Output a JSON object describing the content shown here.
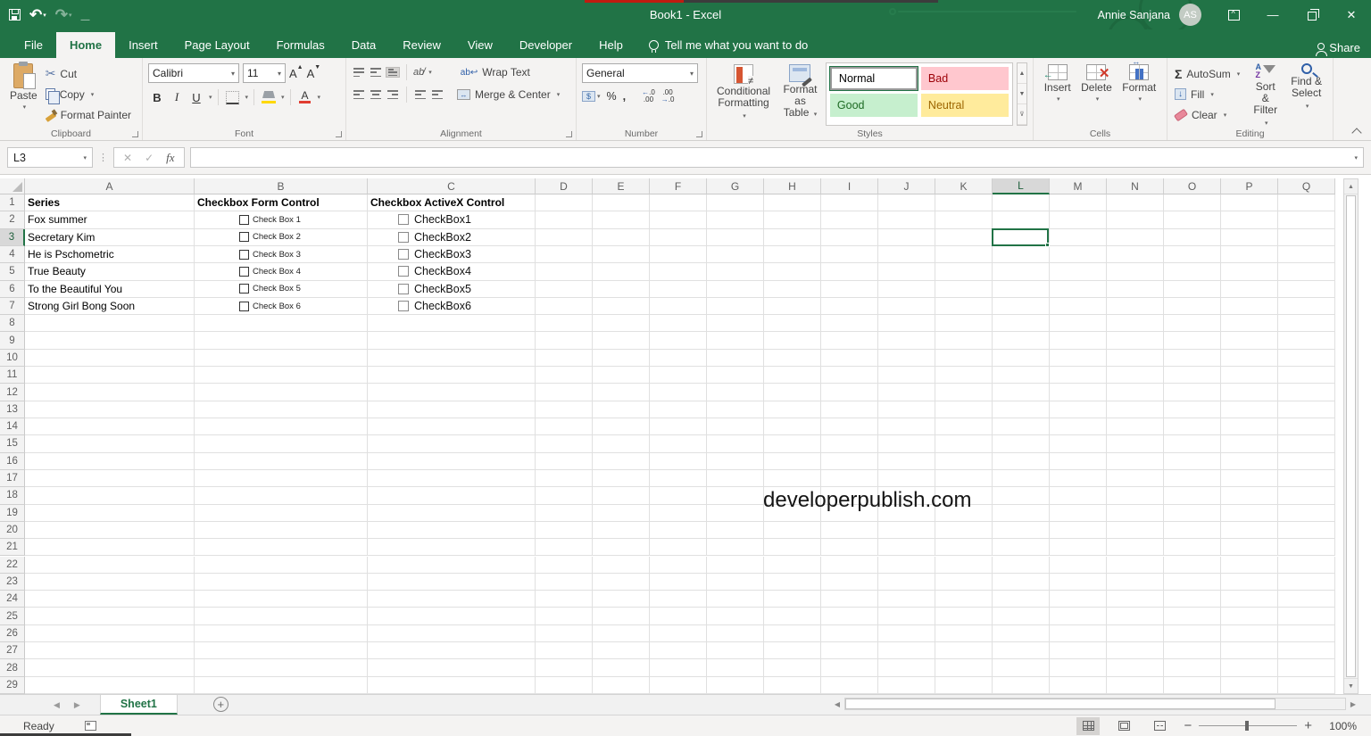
{
  "window": {
    "title": "Book1  -  Excel",
    "user_name": "Annie Sanjana",
    "user_initials": "AS"
  },
  "icons": {
    "cut_glyph": "✂",
    "close_glyph": "✕",
    "check_glyph": "✓",
    "fx_glyph": "fx",
    "minimize_glyph": "—",
    "caret_down": "▾",
    "up_arrow": "▲",
    "down_arrow": "▼",
    "left_arrow": "◀",
    "right_arrow": "▶",
    "undo_glyph": "↶",
    "redo_glyph": "↷",
    "sigma": "Σ",
    "fill_down": "↓",
    "merge_arrows": "↔",
    "wrap_ab": "ab",
    "wrap_return": "↩",
    "orientation": "ab̸",
    "insert_arrow": "←",
    "delete_x": "✕",
    "plus": "+",
    "formula_chevron": "▾",
    "dots": "⋮"
  },
  "tabs": {
    "items": [
      "File",
      "Home",
      "Insert",
      "Page Layout",
      "Formulas",
      "Data",
      "Review",
      "View",
      "Developer",
      "Help"
    ],
    "active": "Home",
    "tell_me": "Tell me what you want to do",
    "share": "Share"
  },
  "ribbon": {
    "clipboard": {
      "label": "Clipboard",
      "paste": "Paste",
      "cut": "Cut",
      "copy": "Copy",
      "format_painter": "Format Painter"
    },
    "font": {
      "label": "Font",
      "name": "Calibri",
      "size": "11",
      "bold": "B",
      "italic": "I",
      "underline": "U",
      "grow": "A",
      "shrink": "A",
      "color_a": "A"
    },
    "alignment": {
      "label": "Alignment",
      "wrap_text": "Wrap Text",
      "merge_center": "Merge & Center"
    },
    "number": {
      "label": "Number",
      "format": "General",
      "percent": "%",
      "comma": ",",
      "inc_decimal": ".00",
      "dec_decimal": ".00",
      "money": "$"
    },
    "styles": {
      "label": "Styles",
      "conditional_line1": "Conditional",
      "conditional_line2": "Formatting",
      "format_table_line1": "Format as",
      "format_table_line2": "Table",
      "normal": "Normal",
      "bad": "Bad",
      "good": "Good",
      "neutral": "Neutral"
    },
    "cells": {
      "label": "Cells",
      "insert": "Insert",
      "delete": "Delete",
      "format": "Format"
    },
    "editing": {
      "label": "Editing",
      "autosum": "AutoSum",
      "fill": "Fill",
      "clear": "Clear",
      "sort_line1": "Sort &",
      "sort_line2": "Filter",
      "find_line1": "Find &",
      "find_line2": "Select",
      "az_a": "A",
      "az_z": "Z"
    }
  },
  "formula_bar": {
    "name_box": "L3"
  },
  "grid": {
    "columns": [
      "A",
      "B",
      "C",
      "D",
      "E",
      "F",
      "G",
      "H",
      "I",
      "J",
      "K",
      "L",
      "M",
      "N",
      "O",
      "P",
      "Q"
    ],
    "row_numbers": [
      1,
      2,
      3,
      4,
      5,
      6,
      7,
      8,
      9,
      10,
      11,
      12,
      13,
      14,
      15,
      16,
      17,
      18,
      19,
      20,
      21,
      22,
      23,
      24,
      25,
      26,
      27,
      28,
      29
    ],
    "selected_cell": "L3",
    "selected_column": "L",
    "selected_row": 3
  },
  "table": {
    "headers": {
      "series": "Series",
      "form": "Checkbox Form Control",
      "activex": "Checkbox ActiveX Control"
    },
    "rows": [
      {
        "series": "Fox summer",
        "form": "Check Box 1",
        "activex": "CheckBox1"
      },
      {
        "series": "Secretary Kim",
        "form": "Check Box 2",
        "activex": "CheckBox2"
      },
      {
        "series": "He is Pschometric",
        "form": "Check Box 3",
        "activex": "CheckBox3"
      },
      {
        "series": "True Beauty",
        "form": "Check Box 4",
        "activex": "CheckBox4"
      },
      {
        "series": "To the Beautiful You",
        "form": "Check Box 5",
        "activex": "CheckBox5"
      },
      {
        "series": "Strong Girl Bong Soon",
        "form": "Check Box 6",
        "activex": "CheckBox6"
      }
    ]
  },
  "watermark": "developerpublish.com",
  "sheet_bar": {
    "active_tab": "Sheet1"
  },
  "status_bar": {
    "ready": "Ready",
    "zoom_level": "100%"
  },
  "colors": {
    "excel_green": "#217346",
    "bad_bg": "#ffc7ce",
    "bad_text": "#9c0006",
    "good_bg": "#c6efce",
    "good_text": "#1e6b24",
    "neutral_bg": "#ffeb9c",
    "neutral_text": "#9c6500"
  }
}
